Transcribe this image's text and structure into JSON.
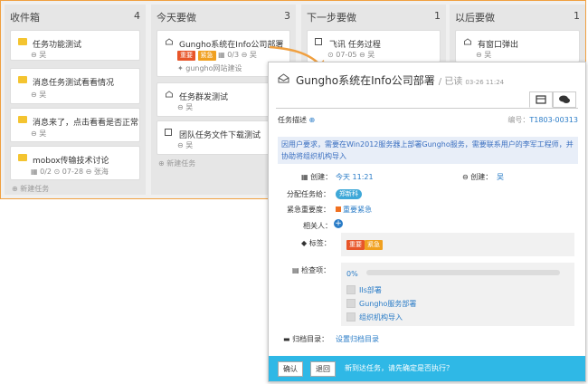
{
  "columns": [
    {
      "title": "收件箱",
      "count": "4",
      "cards": [
        {
          "title": "任务功能测试",
          "user": "吴"
        },
        {
          "title": "消息任务测试看看情况",
          "user": "吴"
        },
        {
          "title": "消息来了，点击看看是否正常",
          "user": "吴"
        },
        {
          "title": "mobox传输技术讨论",
          "check": "0/2",
          "date": "07-28",
          "user": "张海"
        }
      ],
      "add_label": "新建任务"
    },
    {
      "title": "今天要做",
      "count": "3",
      "cards": [
        {
          "title": "Gungho系统在Info公司部署",
          "tag1": "重要",
          "tag2": "紧急",
          "check": "0/3",
          "user": "吴",
          "project": "gungho网站建设"
        },
        {
          "title": "任务群发测试",
          "user": "吴"
        },
        {
          "title": "团队任务文件下载测试",
          "user": "吴"
        }
      ],
      "add_label": "新建任务"
    },
    {
      "title": "下一步要做",
      "count": "1",
      "cards": [
        {
          "title": "飞讯 任务过程",
          "date": "07-05",
          "user": "吴"
        }
      ]
    },
    {
      "title": "以后要做",
      "count": "1",
      "cards": [
        {
          "title": "有窗口弹出",
          "user": "吴"
        }
      ]
    }
  ],
  "modal": {
    "title": "Gungho系统在Info公司部署",
    "status": "/ 已读",
    "status_date": "03-26 11:24",
    "section_label": "任务描述",
    "id_label": "编号：",
    "id_value": "T1803-00313",
    "description": "因用户要求，需要在Win2012服务器上部署Gungho服务，需要联系用户的李军工程师，并协助将组织机构导入",
    "created_label": "创建：",
    "created_value": "今天 11:21",
    "creator_label": "创建：",
    "creator_value": "吴",
    "assignee_label": "分配任务给：",
    "assignee_value": "郑新科",
    "priority_label": "紧急重要度：",
    "priority_value": "重要紧急",
    "related_label": "相关人：",
    "tags_label": "标签：",
    "tags": [
      "重要",
      "紧急"
    ],
    "checklist_label": "检查项：",
    "progress_text": "0%",
    "progress": 0,
    "checklist": [
      "IIs部署",
      "Gungho服务部署",
      "组织机构导入"
    ],
    "archive_label": "归档目录：",
    "archive_value": "设置归档目录",
    "confirm_label": "确认",
    "back_label": "退回",
    "footer_message": "新到达任务，请先确定是否执行？"
  },
  "colors": {
    "accent": "#2fb8e6",
    "link": "#2a7cc7",
    "tag_red": "#e8562a",
    "tag_orange": "#f0a020",
    "highlight_arrow": "#f0a040"
  }
}
